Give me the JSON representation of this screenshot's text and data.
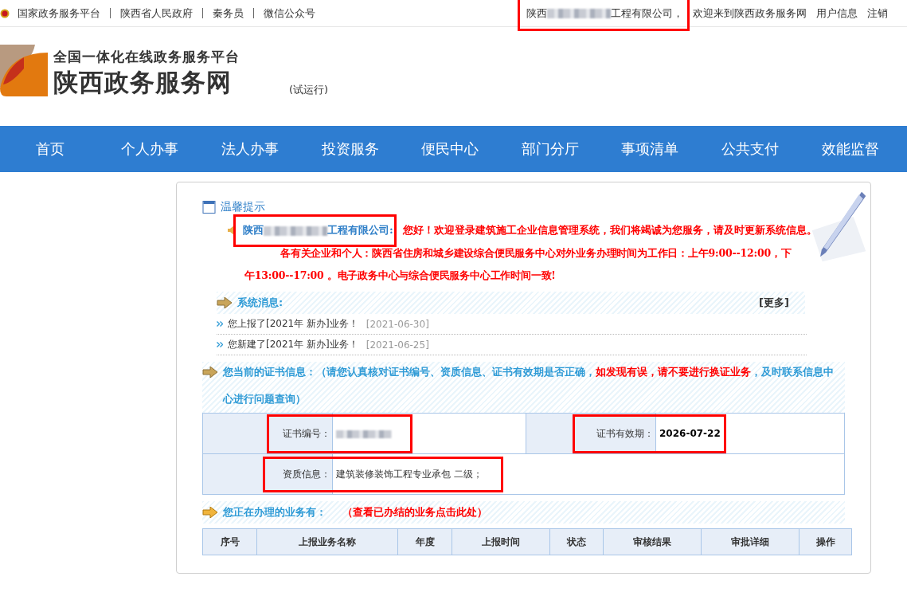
{
  "top_bar": {
    "links": [
      "国家政务服务平台",
      "陕西省人民政府",
      "秦务员",
      "微信公众号"
    ],
    "user": {
      "before": "陕西",
      "redacted": true,
      "after": "工程有限公司，",
      "highlighted": true
    },
    "welcome": "欢迎来到陕西政务服务网",
    "actions": [
      "用户信息",
      "注销"
    ]
  },
  "header": {
    "subtitle": "全国一体化在线政务服务平台",
    "title": "陕西政务服务网",
    "badge": "(试运行)"
  },
  "nav": [
    "首页",
    "个人办事",
    "法人办事",
    "投资服务",
    "便民中心",
    "部门分厅",
    "事项清单",
    "公共支付",
    "效能监督"
  ],
  "notice": {
    "title": "温馨提示",
    "company": {
      "before": "陕西",
      "redacted": true,
      "after": "工程有限公司:",
      "highlighted": true
    },
    "greeting": "您好！欢迎登录建筑施工企业信息管理系统，我们将竭诚为您服务，请及时更新系统信息。",
    "body": "各有关企业和个人：陕西省住房和城乡建设综合便民服务中心对外业务办理时间为工作日：上午9:00--12:00，下午13:00--17:00 。电子政务中心与综合便民服务中心工作时间一致!"
  },
  "messages": {
    "title": "系统消息:",
    "more": "[更多]",
    "items": [
      {
        "text": "您上报了[2021年 新办]业务！",
        "date": "[2021-06-30]"
      },
      {
        "text": "您新建了[2021年 新办]业务！",
        "date": "[2021-06-25]"
      }
    ]
  },
  "certificate": {
    "notice": [
      {
        "kind": "title",
        "text": "您当前的证书信息："
      },
      {
        "kind": "note",
        "text": "（请您认真核对证书编号、资质信息、证书有效期是否正确，"
      },
      {
        "kind": "warning",
        "text": "如发现有误，请不要进行换证业务"
      },
      {
        "kind": "note",
        "text": "，及时联系信息中心进行问题查询）"
      }
    ],
    "number": {
      "label": "证书编号：",
      "redacted": true,
      "highlighted": true
    },
    "validity": {
      "label": "证书有效期：",
      "value": "2026-07-22",
      "highlighted": true
    },
    "qualification": {
      "label": "资质信息：",
      "value": "建筑装修装饰工程专业承包 二级；",
      "highlighted": true
    }
  },
  "business": {
    "title": "您正在办理的业务有：",
    "link": "（查看已办结的业务点击此处）",
    "columns": [
      "序号",
      "上报业务名称",
      "年度",
      "上报时间",
      "状态",
      "审核结果",
      "审批详细",
      "操作"
    ]
  }
}
